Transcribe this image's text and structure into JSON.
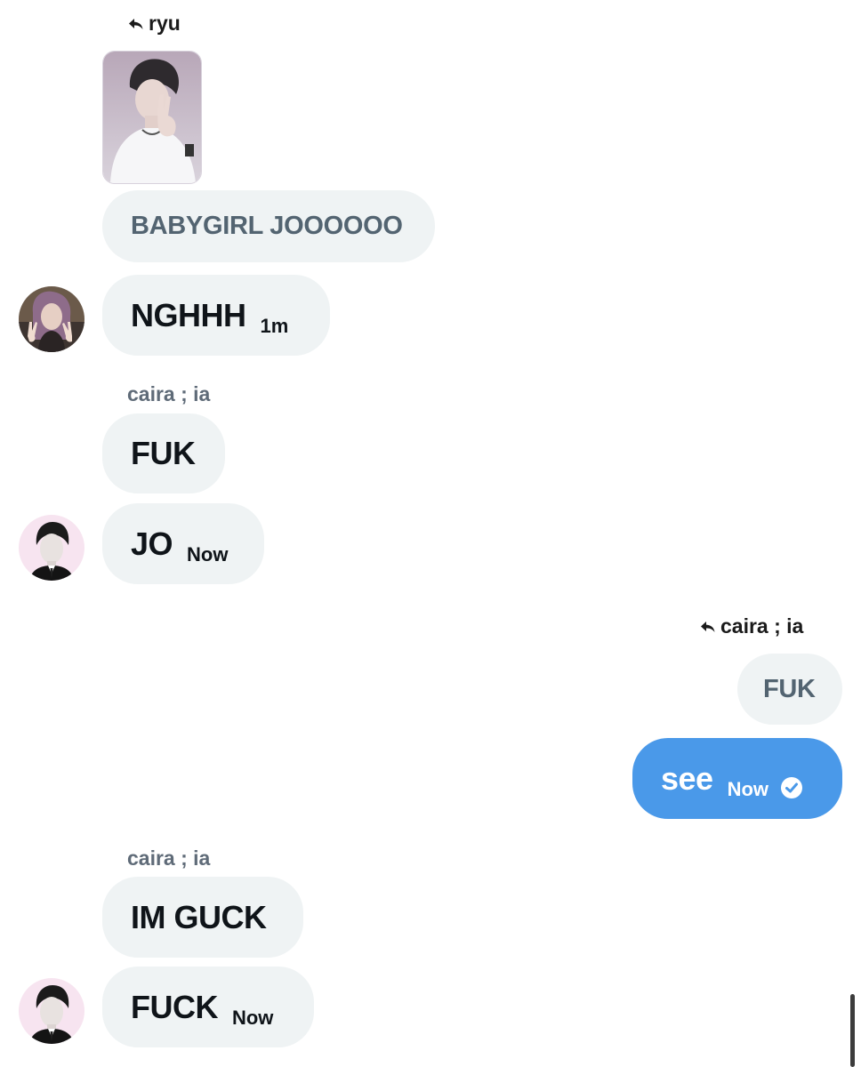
{
  "conversation": {
    "block1": {
      "reply_to": "ryu",
      "quoted_text": "BABYGIRL JOOOOOO",
      "message": "NGHHH",
      "time": "1m"
    },
    "block2": {
      "sender": "caira ; ia",
      "messages": [
        "FUK",
        "JO"
      ],
      "time": "Now"
    },
    "own": {
      "reply_to": "caira ; ia",
      "quoted_text": "FUK",
      "message": "see",
      "time": "Now",
      "status_icon": "check-circle-icon"
    },
    "block3": {
      "sender": "caira ; ia",
      "messages": [
        "IM GUCK",
        "FUCK"
      ],
      "time": "Now"
    }
  },
  "colors": {
    "bubble_bg": "#eff3f4",
    "own_bubble_bg": "#4a99e9",
    "name_gray": "#5f6b78",
    "text_dark": "#0f1419"
  }
}
